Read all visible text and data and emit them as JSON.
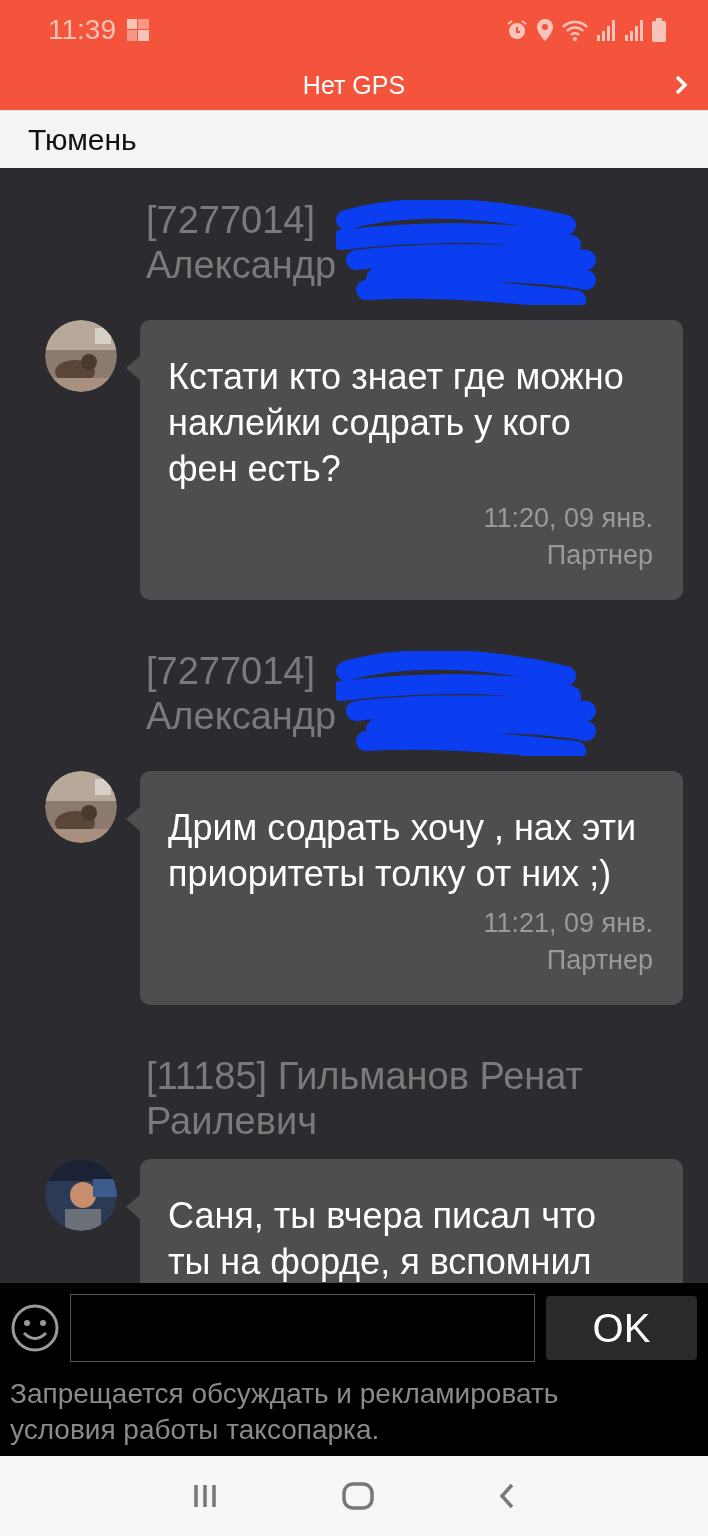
{
  "status_bar": {
    "time": "11:39"
  },
  "header": {
    "title": "Нет GPS"
  },
  "city_bar": {
    "title": "Тюмень"
  },
  "messages": [
    {
      "header": "[7277014]\nАлександр",
      "redacted": true,
      "text": "Кстати кто знает где можно наклейки содрать у кого фен есть?",
      "time": "11:20, 09 янв.",
      "role": "Партнер"
    },
    {
      "header": "[7277014]\nАлександр",
      "redacted": true,
      "text": "Дрим содрать хочу ,  нах эти приоритеты толку от них ;)",
      "time": "11:21, 09 янв.",
      "role": "Партнер"
    },
    {
      "header": "[11185] Гильманов Ренат\nРаилевич",
      "redacted": false,
      "text": "Саня, ты вчера писал что ты на форде, я вспомнил"
    }
  ],
  "composer": {
    "button": "OK",
    "notice": "Запрещается обсуждать и рекламировать условия работы таксопарка."
  }
}
